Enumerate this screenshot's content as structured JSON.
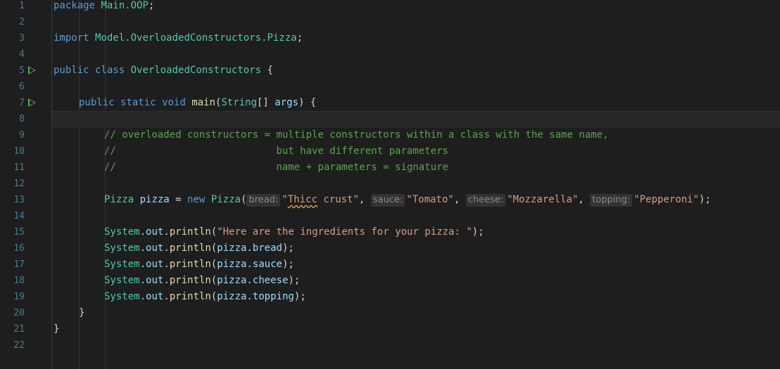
{
  "colors": {
    "background": "#1e1e1e",
    "keyword": "#569cd6",
    "type": "#4ec9b0",
    "string": "#d69d85",
    "comment": "#57a64a",
    "run_icon": "#4caf50"
  },
  "line_numbers": [
    "1",
    "2",
    "3",
    "4",
    "5",
    "6",
    "7",
    "8",
    "9",
    "10",
    "11",
    "12",
    "13",
    "14",
    "15",
    "16",
    "17",
    "18",
    "19",
    "20",
    "21",
    "22"
  ],
  "run_markers": [
    5,
    7
  ],
  "code": {
    "l1": {
      "kw": "package",
      "pkg": "Main.OOP",
      "end": ";"
    },
    "l3": {
      "kw": "import",
      "pkg": "Model.OverloadedConstructors.Pizza",
      "end": ";"
    },
    "l5": {
      "kw1": "public",
      "kw2": "class",
      "name": "OverloadedConstructors",
      "end": "{"
    },
    "l7": {
      "kw1": "public",
      "kw2": "static",
      "kw3": "void",
      "method": "main",
      "p1": "(",
      "type": "String",
      "p2": "[] ",
      "arg": "args",
      "p3": ") {"
    },
    "l9": "// overloaded constructors = multiple constructors within a class with the same name,",
    "l10": "//                           but have different parameters",
    "l11": "//                           name + parameters = signature",
    "l13": {
      "type": "Pizza",
      "var": "pizza",
      "eq": " = ",
      "kw_new": "new",
      "ctor": "Pizza",
      "open": "(",
      "hint1": "bread:",
      "s1_a": "\"",
      "s1_b": "Thicc",
      "s1_c": " crust\"",
      "sep1": ", ",
      "hint2": "sauce:",
      "s2": "\"Tomato\"",
      "sep2": ", ",
      "hint3": "cheese:",
      "s3": "\"Mozzarella\"",
      "sep3": ", ",
      "hint4": "topping:",
      "s4": "\"Pepperoni\"",
      "close": ");"
    },
    "l15": {
      "obj": "System",
      "dot1": ".",
      "field": "out",
      "dot2": ".",
      "method": "println",
      "open": "(",
      "str": "\"Here are the ingredients for your pizza: \"",
      "close": ");"
    },
    "l16": {
      "obj": "System",
      "field": "out",
      "method": "println",
      "var": "pizza",
      "prop": "bread"
    },
    "l17": {
      "obj": "System",
      "field": "out",
      "method": "println",
      "var": "pizza",
      "prop": "sauce"
    },
    "l18": {
      "obj": "System",
      "field": "out",
      "method": "println",
      "var": "pizza",
      "prop": "cheese"
    },
    "l19": {
      "obj": "System",
      "field": "out",
      "method": "println",
      "var": "pizza",
      "prop": "topping"
    },
    "l20": "}",
    "l21": "}"
  }
}
